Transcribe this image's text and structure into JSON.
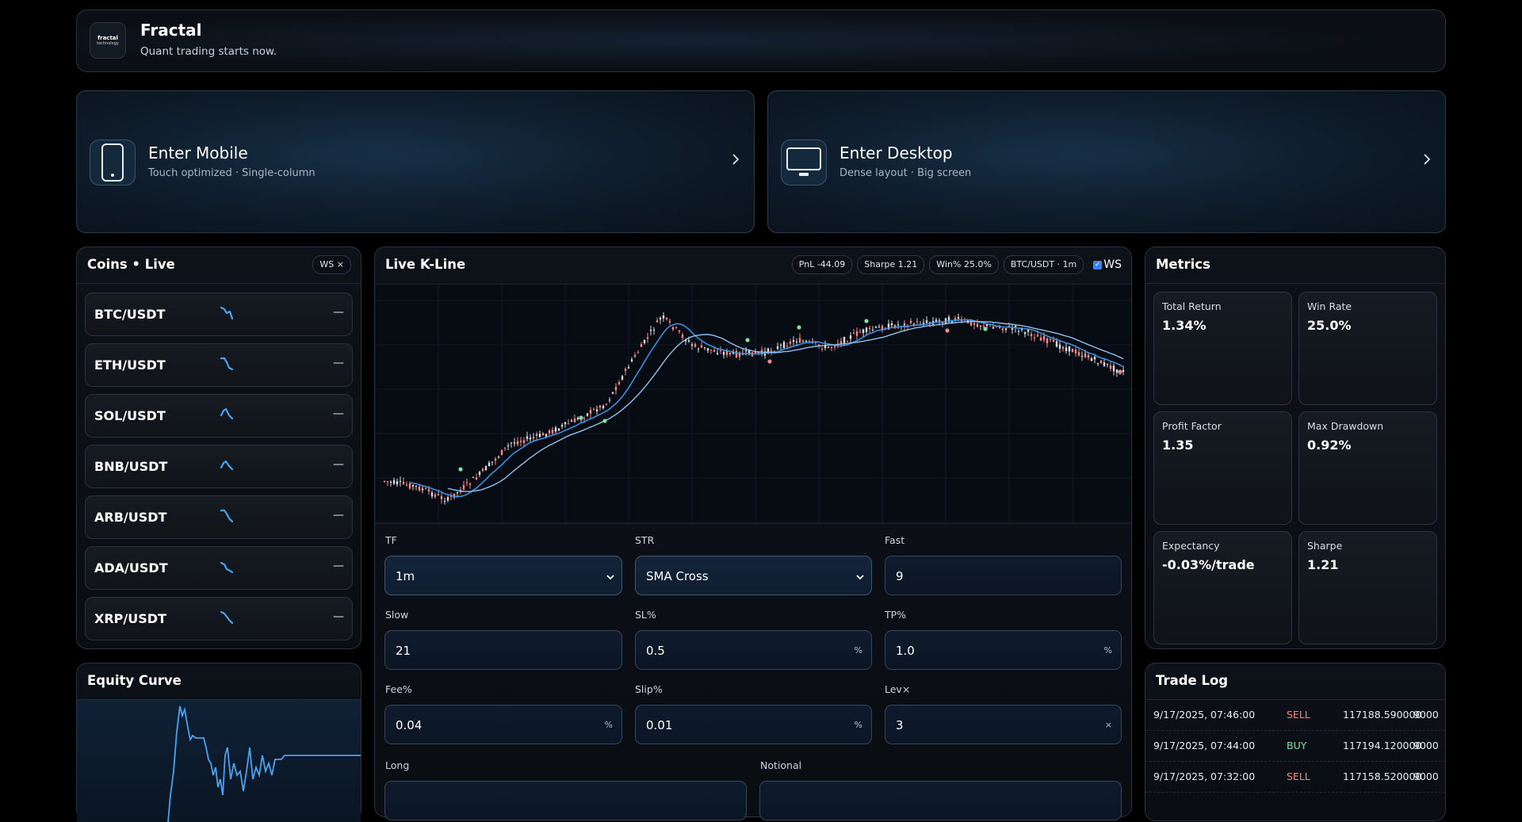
{
  "header": {
    "logo_line1": "fractal",
    "logo_line2": "technology",
    "title": "Fractal",
    "subtitle": "Quant trading starts now."
  },
  "enter_mobile": {
    "title": "Enter Mobile",
    "subtitle": "Touch optimized · Single-column",
    "icon": "smartphone-icon"
  },
  "enter_desktop": {
    "title": "Enter Desktop",
    "subtitle": "Dense layout · Big screen",
    "icon": "monitor-icon"
  },
  "coins": {
    "title": "Coins • Live",
    "badge": "WS ×",
    "items": [
      {
        "symbol": "BTC/USDT",
        "value": "—"
      },
      {
        "symbol": "ETH/USDT",
        "value": "—"
      },
      {
        "symbol": "SOL/USDT",
        "value": "—"
      },
      {
        "symbol": "BNB/USDT",
        "value": "—"
      },
      {
        "symbol": "ARB/USDT",
        "value": "—"
      },
      {
        "symbol": "ADA/USDT",
        "value": "—"
      },
      {
        "symbol": "XRP/USDT",
        "value": "—"
      }
    ]
  },
  "equity": {
    "title": "Equity Curve"
  },
  "kline": {
    "title": "Live K-Line",
    "pills": [
      "PnL -44.09",
      "Sharpe 1.21",
      "Win% 25.0%",
      "BTC/USDT · 1m"
    ],
    "ws_label": "WS",
    "ws_checked": true
  },
  "form": {
    "tf": {
      "label": "TF",
      "value": "1m"
    },
    "str": {
      "label": "STR",
      "value": "SMA Cross"
    },
    "fast": {
      "label": "Fast",
      "value": "9"
    },
    "slow": {
      "label": "Slow",
      "value": "21"
    },
    "sl": {
      "label": "SL%",
      "value": "0.5",
      "unit": "%"
    },
    "tp": {
      "label": "TP%",
      "value": "1.0",
      "unit": "%"
    },
    "fee": {
      "label": "Fee%",
      "value": "0.04",
      "unit": "%"
    },
    "slip": {
      "label": "Slip%",
      "value": "0.01",
      "unit": "%"
    },
    "lev": {
      "label": "Lev×",
      "value": "3",
      "unit": "×"
    },
    "long": {
      "label": "Long"
    },
    "notional": {
      "label": "Notional"
    }
  },
  "metrics": {
    "title": "Metrics",
    "items": [
      {
        "label": "Total Return",
        "value": "1.34%"
      },
      {
        "label": "Win Rate",
        "value": "25.0%"
      },
      {
        "label": "Profit Factor",
        "value": "1.35"
      },
      {
        "label": "Max Drawdown",
        "value": "0.92%"
      },
      {
        "label": "Expectancy",
        "value": "-0.03%/trade"
      },
      {
        "label": "Sharpe",
        "value": "1.21"
      }
    ]
  },
  "tradelog": {
    "title": "Trade Log",
    "rows": [
      {
        "time": "9/17/2025, 07:46:00",
        "side": "SELL",
        "price": "117188.590000",
        "qty": "9000"
      },
      {
        "time": "9/17/2025, 07:44:00",
        "side": "BUY",
        "price": "117194.120000",
        "qty": "9000"
      },
      {
        "time": "9/17/2025, 07:32:00",
        "side": "SELL",
        "price": "117158.520000",
        "qty": "9000"
      }
    ]
  },
  "colors": {
    "accent": "#4aa3f0",
    "buy": "#7ee2a8",
    "sell": "#f08a8a",
    "candle_up": "#d9dde3",
    "candle_down": "#f08a8a"
  }
}
